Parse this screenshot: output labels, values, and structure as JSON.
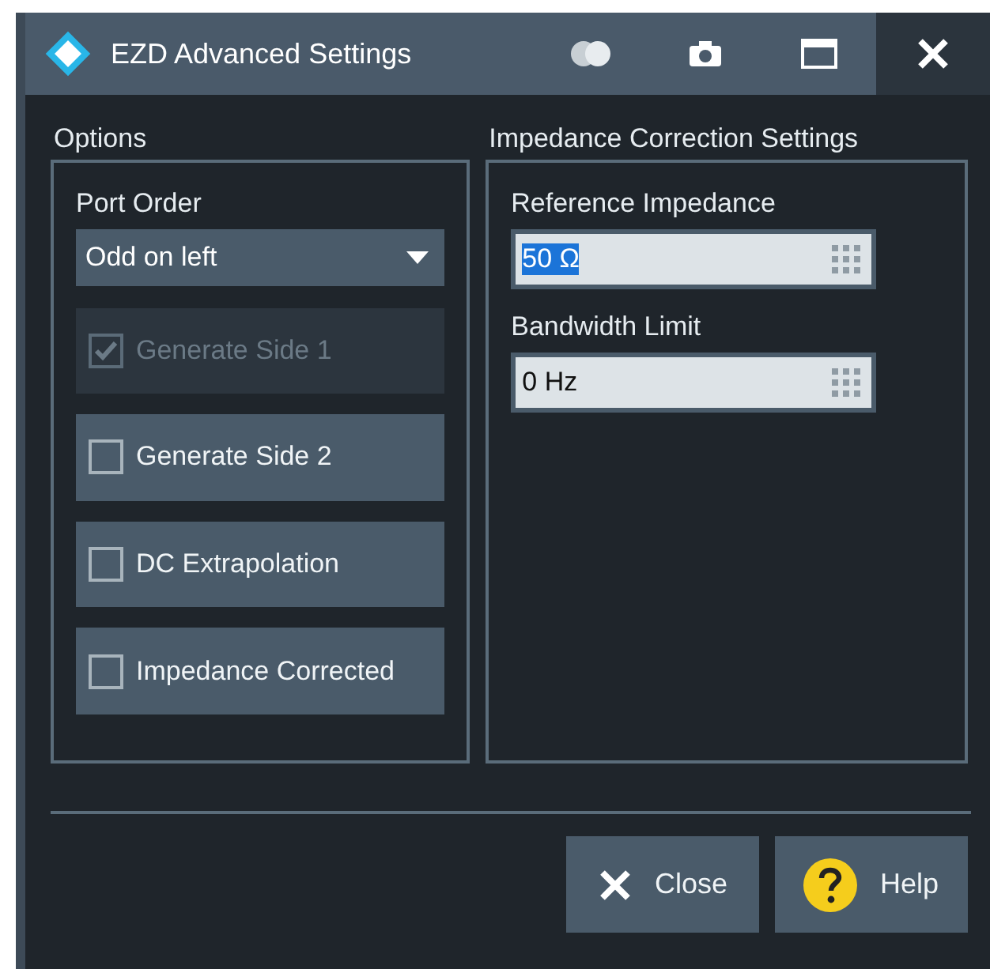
{
  "window": {
    "title": "EZD Advanced Settings"
  },
  "options": {
    "title": "Options",
    "port_order": {
      "label": "Port Order",
      "value": "Odd on left"
    },
    "checkboxes": [
      {
        "label": "Generate Side 1",
        "checked": true,
        "disabled": true
      },
      {
        "label": "Generate Side 2",
        "checked": false,
        "disabled": false
      },
      {
        "label": "DC Extrapolation",
        "checked": false,
        "disabled": false
      },
      {
        "label": "Impedance Corrected",
        "checked": false,
        "disabled": false
      }
    ]
  },
  "impedance": {
    "title": "Impedance Correction Settings",
    "fields": [
      {
        "label": "Reference Impedance",
        "value": "50 Ω",
        "selected": true
      },
      {
        "label": "Bandwidth Limit",
        "value": "0 Hz",
        "selected": false
      }
    ]
  },
  "buttons": [
    {
      "kind": "close",
      "label": "Close"
    },
    {
      "kind": "help",
      "label": "Help"
    }
  ]
}
